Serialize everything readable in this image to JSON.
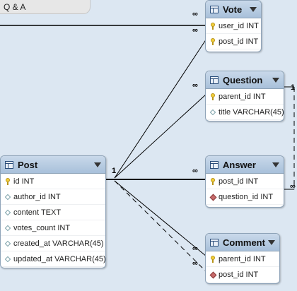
{
  "layer": {
    "title": "Q & A"
  },
  "tables": {
    "vote": {
      "name": "Vote",
      "columns": [
        {
          "text": "user_id INT",
          "kind": "key"
        },
        {
          "text": "post_id INT",
          "kind": "key"
        }
      ]
    },
    "question": {
      "name": "Question",
      "columns": [
        {
          "text": "parent_id INT",
          "kind": "key"
        },
        {
          "text": "title VARCHAR(45)",
          "kind": "column"
        }
      ]
    },
    "answer": {
      "name": "Answer",
      "columns": [
        {
          "text": "post_id INT",
          "kind": "key"
        },
        {
          "text": "question_id INT",
          "kind": "foreign-key"
        }
      ]
    },
    "comment": {
      "name": "Comment",
      "columns": [
        {
          "text": "parent_id INT",
          "kind": "key"
        },
        {
          "text": "post_id INT",
          "kind": "foreign-key"
        }
      ]
    },
    "post": {
      "name": "Post",
      "columns": [
        {
          "text": "id INT",
          "kind": "key"
        },
        {
          "text": "author_id INT",
          "kind": "column"
        },
        {
          "text": "content TEXT",
          "kind": "column"
        },
        {
          "text": "votes_count INT",
          "kind": "column"
        },
        {
          "text": "created_at VARCHAR(45)",
          "kind": "column"
        },
        {
          "text": "updated_at VARCHAR(45)",
          "kind": "column"
        }
      ]
    }
  },
  "cardinality": {
    "one": "1",
    "many": "∞"
  },
  "colors": {
    "header": "#a8c0da",
    "border": "#8ea3b8",
    "canvas": "#dce7f2"
  }
}
